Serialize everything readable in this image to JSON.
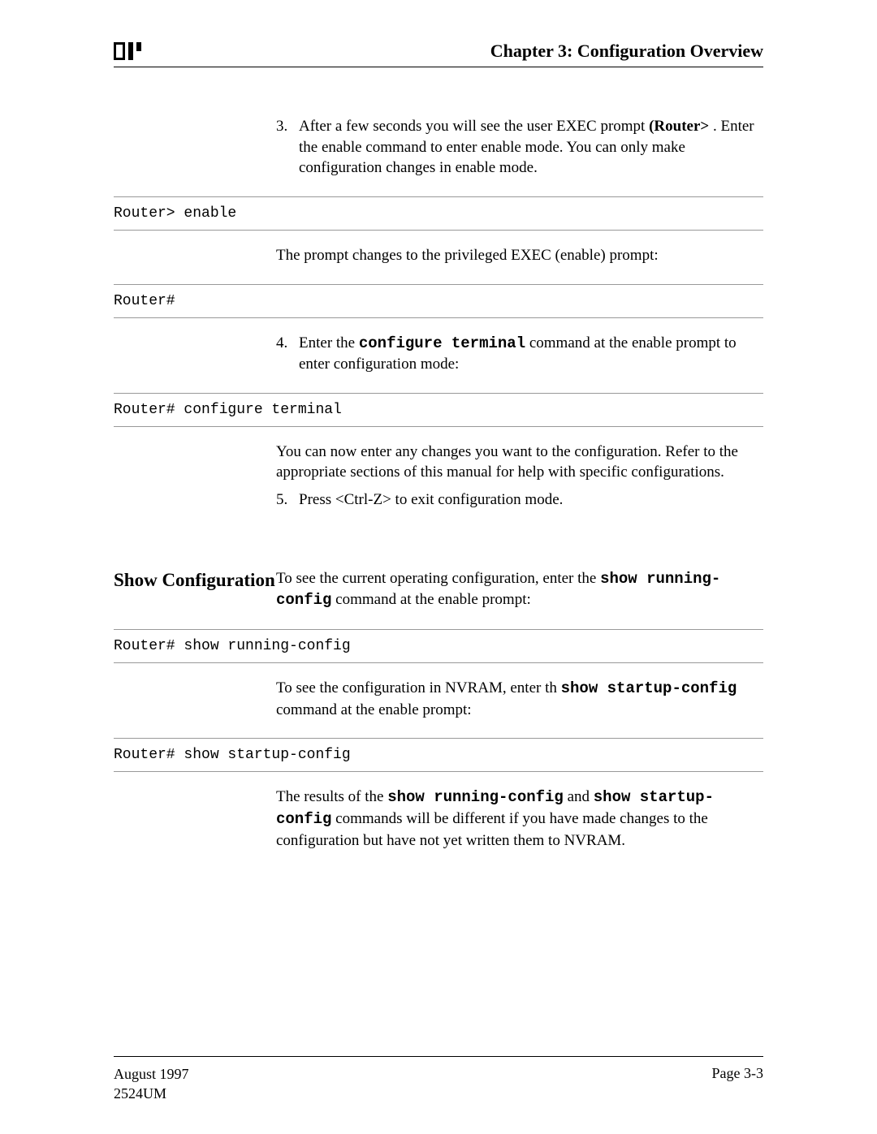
{
  "header": {
    "chapter_title": "Chapter 3: Configuration Overview"
  },
  "step3": {
    "num": "3.",
    "text_before_bold": "After a few seconds you will see the user EXEC prompt ",
    "bold": "(Router>",
    "text_after_bold": " . Enter the enable command to enter enable mode. You can only make configuration changes in enable mode."
  },
  "code1": "Router> enable",
  "para1": "The prompt changes to the privileged EXEC (enable) prompt:",
  "code2": "Router#",
  "step4": {
    "num": "4.",
    "text_before": "Enter the ",
    "cmd": "configure terminal",
    "text_after": " command at the enable prompt to enter configuration mode:"
  },
  "code3": "Router# configure terminal",
  "para2": "You can now enter any changes you want to the configuration. Refer to the appropriate sections of this manual for help with specific configurations.",
  "step5": {
    "num": "5.",
    "text": "Press <Ctrl-Z> to exit configuration mode."
  },
  "section2": {
    "heading": "Show Configuration",
    "para1_before": "To see the current operating configuration, enter the ",
    "para1_cmd": "show running-config",
    "para1_after": " command at the enable prompt:"
  },
  "code4": "Router# show running-config",
  "para3_before": "To see the configuration in NVRAM, enter th  ",
  "para3_cmd": "show startup-config",
  "para3_after": " command at the enable prompt:",
  "code5": "Router# show startup-config",
  "para4_before": "The results of the ",
  "para4_cmd1": "show running-config",
  "para4_mid": " and ",
  "para4_cmd2": "show startup-config",
  "para4_after": " commands will be different if you have made changes to the configuration but have not yet written them to NVRAM.",
  "footer": {
    "date": "August 1997",
    "doc_id": "2524UM",
    "page": "Page 3-3"
  }
}
